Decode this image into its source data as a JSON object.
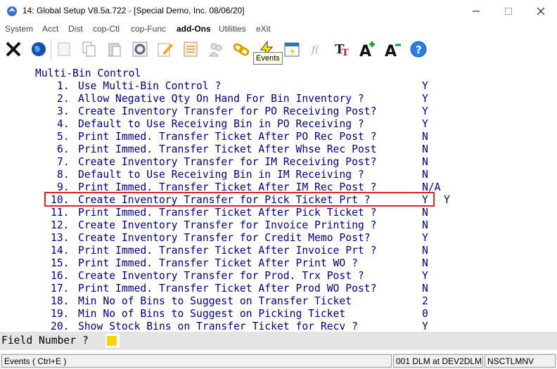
{
  "window": {
    "title": "14: Global Setup V8.5a.722 - [Special Demo, Inc. 08/06/20]"
  },
  "menu": [
    "System",
    "Acct",
    "Dist",
    "cop-Ctl",
    "cop-Func",
    "add-Ons",
    "Utilities",
    "eXit"
  ],
  "toolbar": {
    "icons": [
      "close-icon",
      "globe-icon",
      "blank-icon",
      "copy-icon",
      "paste-icon",
      "settings-icon",
      "edit-icon",
      "notes-icon",
      "users-icon",
      "link-icon",
      "events-icon",
      "calendar-icon",
      "script-icon",
      "text-format-icon",
      "font-increase-icon",
      "font-decrease-icon",
      "help-icon"
    ],
    "tooltip": "Events"
  },
  "console": {
    "heading": "Multi-Bin Control",
    "rows": [
      {
        "num": "1.",
        "label": "Use Multi-Bin Control ?",
        "value": "Y"
      },
      {
        "num": "2.",
        "label": "Allow Negative Qty On Hand For Bin Inventory ?",
        "value": "Y"
      },
      {
        "num": "3.",
        "label": "Create Inventory Transfer for PO Receiving Post?",
        "value": "Y"
      },
      {
        "num": "4.",
        "label": "Default to Use Receiving Bin in PO Receiving ?",
        "value": "Y"
      },
      {
        "num": "5.",
        "label": "Print Immed. Transfer Ticket After PO Rec Post ?",
        "value": "N"
      },
      {
        "num": "6.",
        "label": "Print Immed. Transfer Ticket After Whse Rec Post",
        "value": "N"
      },
      {
        "num": "7.",
        "label": "Create Inventory Transfer for IM Receiving Post?",
        "value": "N"
      },
      {
        "num": "8.",
        "label": "Default to Use Receiving Bin in IM Receiving ?",
        "value": "N"
      },
      {
        "num": "9.",
        "label": "Print Immed. Transfer Ticket After IM Rec Post ?",
        "value": "N/A"
      },
      {
        "num": "10.",
        "label": "Create Inventory Transfer for Pick Ticket Prt ?",
        "value": "Y"
      },
      {
        "num": "11.",
        "label": "Print Immed. Transfer Ticket After Pick Ticket ?",
        "value": "N"
      },
      {
        "num": "12.",
        "label": "Create Inventory Transfer for Invoice Printing ?",
        "value": "N"
      },
      {
        "num": "13.",
        "label": "Create Inventory Transfer for Credit Memo Post?",
        "value": "Y"
      },
      {
        "num": "14.",
        "label": "Print Immed. Transfer Ticket After Invoice Prt ?",
        "value": "N"
      },
      {
        "num": "15.",
        "label": "Print Immed. Transfer Ticket After Print WO ?",
        "value": "N"
      },
      {
        "num": "16.",
        "label": "Create Inventory Transfer for Prod. Trx Post ?",
        "value": "Y"
      },
      {
        "num": "17.",
        "label": "Print Immed. Transfer Ticket After Prod WO Post?",
        "value": "N"
      },
      {
        "num": "18.",
        "label": "Min No of Bins to Suggest on Transfer Ticket",
        "value": "2"
      },
      {
        "num": "19.",
        "label": "Min No of Bins to Suggest on Picking Ticket",
        "value": "0"
      },
      {
        "num": "20.",
        "label": "Show Stock Bins on Transfer Ticket for Recv ?",
        "value": "Y"
      }
    ],
    "edit_value": "Y",
    "highlight_color": "#e0222a",
    "text_color": "#000080"
  },
  "prompt": {
    "label": "Field Number ?",
    "value": ""
  },
  "status": {
    "left": "Events ( Ctrl+E )",
    "middle": "001 DLM at DEV2DLM",
    "right": "NSCTLMNV"
  }
}
